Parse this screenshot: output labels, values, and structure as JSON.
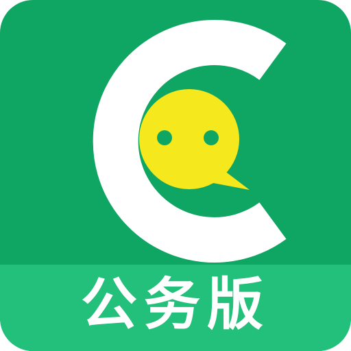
{
  "app_icon": {
    "edition_label": "公务版",
    "logo_icon": "c-chat-bubble-face-icon",
    "colors": {
      "background": "#0fa663",
      "band": "#22c07a",
      "letter_c": "#ffffff",
      "bubble": "#f5e81c",
      "eyes": "#0fa663",
      "label": "#ffffff"
    }
  }
}
